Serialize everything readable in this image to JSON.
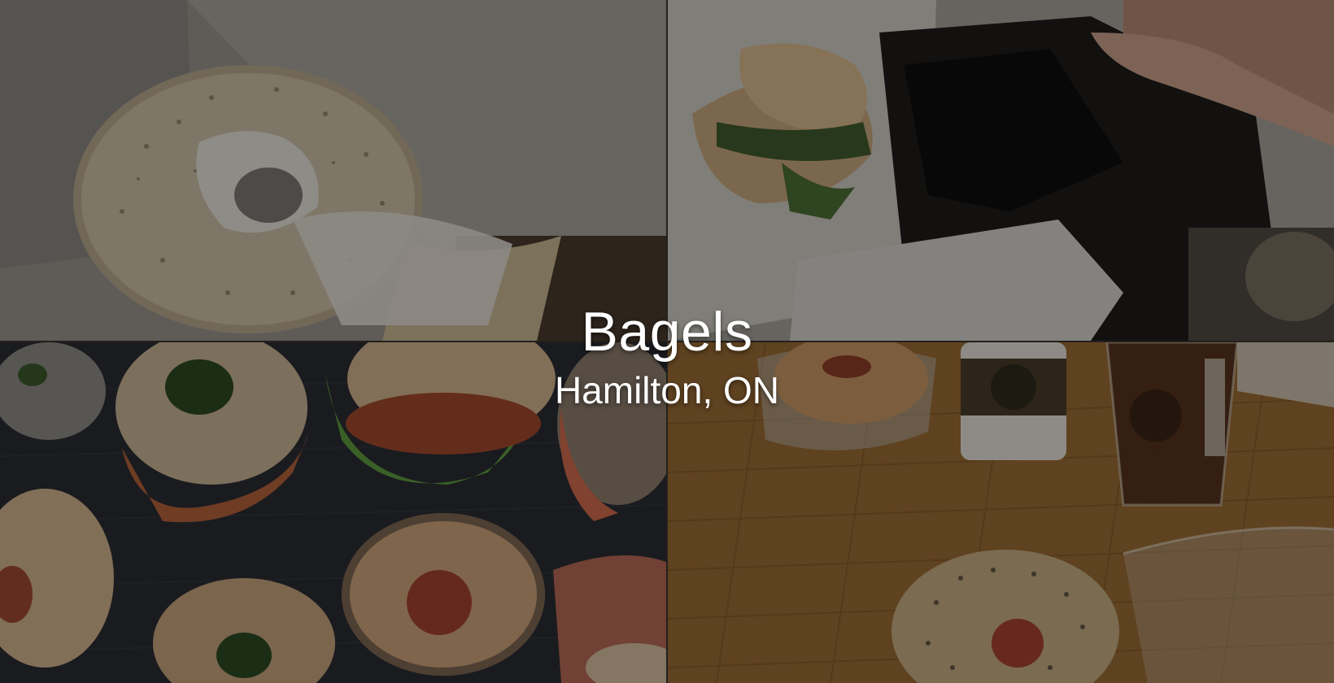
{
  "hero": {
    "title": "Bagels",
    "location": "Hamilton, ON"
  },
  "photos": [
    {
      "subject": "sesame-bagel-with-cream-cheese"
    },
    {
      "subject": "bagel-sandwich-on-wrapper"
    },
    {
      "subject": "assorted-bagel-sandwiches"
    },
    {
      "subject": "bagels-and-starbucks-drinks"
    }
  ],
  "colors": {
    "overlay": "rgba(0,0,0,0.38)",
    "caption_text": "#ffffff"
  }
}
